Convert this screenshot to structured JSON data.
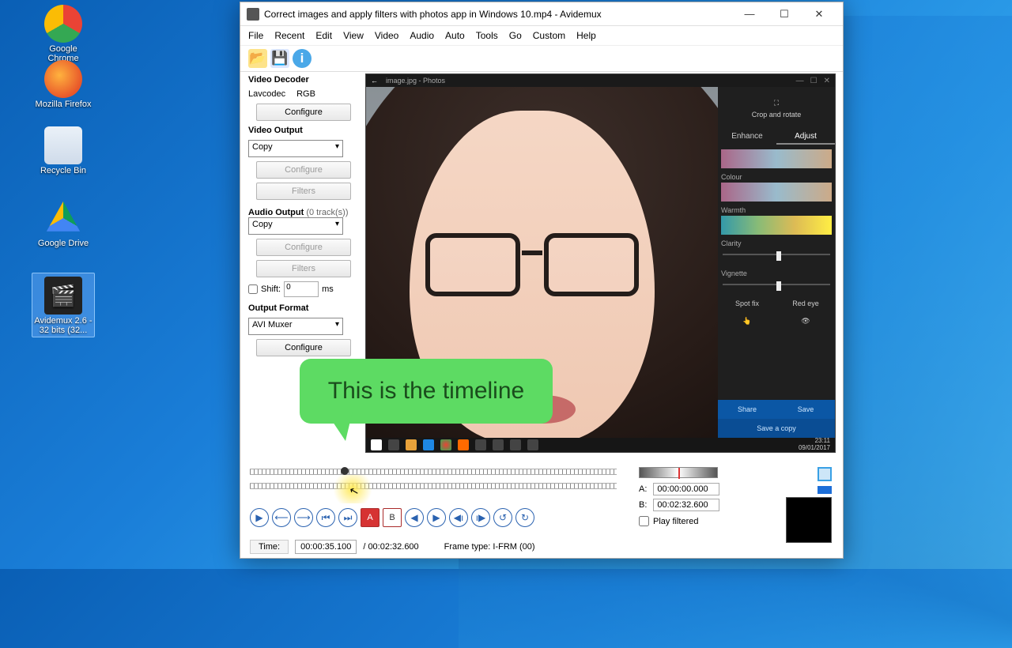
{
  "desktop": {
    "icons": [
      {
        "label": "Google Chrome"
      },
      {
        "label": "Mozilla Firefox"
      },
      {
        "label": "Recycle Bin"
      },
      {
        "label": "Google Drive"
      },
      {
        "label": "Avidemux 2.6 - 32 bits (32..."
      }
    ]
  },
  "window": {
    "title": "Correct images and apply filters with photos app in Windows 10.mp4 - Avidemux",
    "menus": [
      "File",
      "Recent",
      "Edit",
      "View",
      "Video",
      "Audio",
      "Auto",
      "Tools",
      "Go",
      "Custom",
      "Help"
    ],
    "left": {
      "decoder_h": "Video Decoder",
      "lavcodec": "Lavcodec",
      "rgb": "RGB",
      "configure": "Configure",
      "videoout_h": "Video Output",
      "copy": "Copy",
      "filters": "Filters",
      "audioout_h": "Audio Output",
      "audioout_note": "(0 track(s))",
      "shift": "Shift:",
      "shift_val": "0",
      "ms": "ms",
      "outfmt_h": "Output Format",
      "avi": "AVI Muxer",
      "configure2": "Configure"
    },
    "preview": {
      "title": "image.jpg - Photos",
      "crop": "Crop and rotate",
      "enhance": "Enhance",
      "adjust": "Adjust",
      "colour": "Colour",
      "warmth": "Warmth",
      "clarity": "Clarity",
      "vignette": "Vignette",
      "spotfix": "Spot fix",
      "redeye": "Red eye",
      "share": "Share",
      "save": "Save",
      "savecopy": "Save a copy",
      "clock": "23:11",
      "date": "09/01/2017"
    },
    "bottom": {
      "time_label": "Time:",
      "time": "00:00:35.100",
      "dur": "/ 00:02:32.600",
      "frametype": "Frame type:  I-FRM (00)",
      "a_label": "A:",
      "a": "00:00:00.000",
      "b_label": "B:",
      "b": "00:02:32.600",
      "playfiltered": "Play filtered"
    }
  },
  "callout": "This is the timeline"
}
